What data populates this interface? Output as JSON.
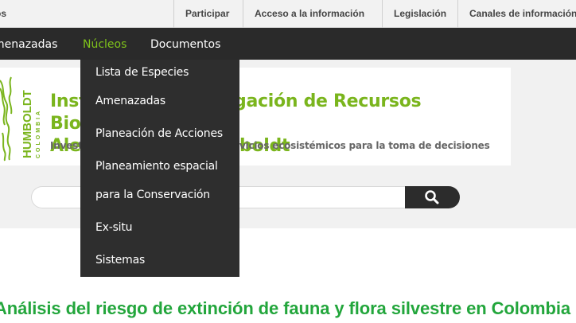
{
  "topbar": {
    "first_label": "os",
    "links": [
      "Participar",
      "Acceso a la información",
      "Legislación",
      "Canales de información"
    ]
  },
  "mainnav": {
    "items": [
      "menazadas",
      "Núcleos",
      "Documentos"
    ],
    "active_color": "#7fc31b"
  },
  "dropdown": {
    "items": [
      "Lista de Especies",
      "Amenazadas",
      "Planeación de Acciones",
      "Planeamiento espacial",
      "para la Conservación",
      "Ex-situ",
      "Sistemas"
    ]
  },
  "header": {
    "logo_text": "HUMBOLDT",
    "logo_subtext": "COLOMBIA",
    "title_line1": "Instituto de Investigación de Recursos Biológicos",
    "title_line2": "Alexander von Humboldt",
    "subtitle": "Investigación en biodiversidad y servicios ecosistémicos para la toma de decisiones",
    "brand_color": "#7ab51d"
  },
  "search": {
    "placeholder": "",
    "button_icon": "search-icon"
  },
  "page": {
    "heading": "Análisis del riesgo de extinción de fauna y flora silvestre en Colombia",
    "heading_color": "#23a63c"
  }
}
